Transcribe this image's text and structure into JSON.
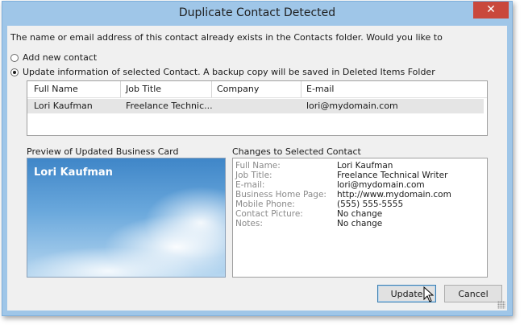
{
  "window": {
    "title": "Duplicate Contact Detected",
    "close_glyph": "✕"
  },
  "prompt": "The name or email address of this contact already exists in the Contacts folder. Would you like to",
  "options": [
    {
      "label": "Add new contact",
      "selected": false
    },
    {
      "label": "Update information of selected Contact. A backup copy will be saved in Deleted Items Folder",
      "selected": true
    }
  ],
  "grid": {
    "columns": [
      "Full Name",
      "Job Title",
      "Company",
      "E-mail"
    ],
    "rows": [
      [
        "Lori Kaufman",
        "Freelance Technic...",
        "",
        "lori@mydomain.com"
      ]
    ]
  },
  "preview": {
    "label": "Preview of Updated Business Card",
    "card_name": "Lori Kaufman"
  },
  "changes": {
    "label": "Changes to Selected Contact",
    "items": [
      {
        "label": "Full Name:",
        "value": "Lori Kaufman"
      },
      {
        "label": "Job Title:",
        "value": "Freelance Technical Writer"
      },
      {
        "label": "E-mail:",
        "value": "lori@mydomain.com"
      },
      {
        "label": "Business Home Page:",
        "value": "http://www.mydomain.com"
      },
      {
        "label": "Mobile Phone:",
        "value": "(555) 555-5555"
      },
      {
        "label": "Contact Picture:",
        "value": "No change"
      },
      {
        "label": "Notes:",
        "value": "No change"
      }
    ]
  },
  "buttons": {
    "update": "Update",
    "cancel": "Cancel"
  },
  "icons": {
    "close": "close-icon",
    "cursor": "mouse-pointer-icon",
    "grip": "resize-grip-icon"
  }
}
